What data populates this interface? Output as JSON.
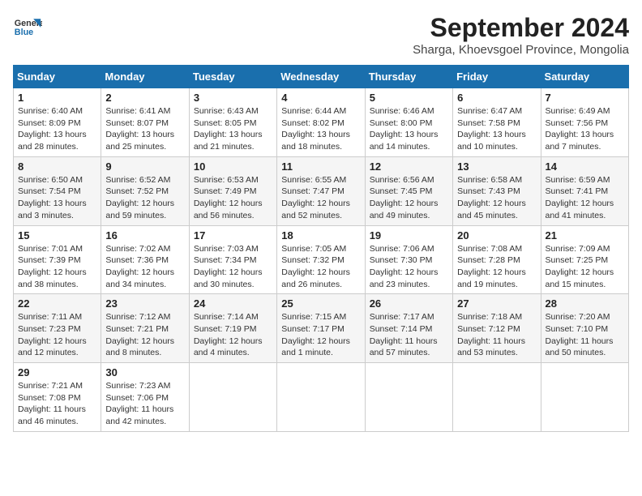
{
  "header": {
    "logo_line1": "General",
    "logo_line2": "Blue",
    "main_title": "September 2024",
    "subtitle": "Sharga, Khoevsgoel Province, Mongolia"
  },
  "calendar": {
    "days_of_week": [
      "Sunday",
      "Monday",
      "Tuesday",
      "Wednesday",
      "Thursday",
      "Friday",
      "Saturday"
    ],
    "weeks": [
      [
        null,
        {
          "day": "2",
          "sunrise": "Sunrise: 6:41 AM",
          "sunset": "Sunset: 8:07 PM",
          "daylight": "Daylight: 13 hours and 25 minutes."
        },
        {
          "day": "3",
          "sunrise": "Sunrise: 6:43 AM",
          "sunset": "Sunset: 8:05 PM",
          "daylight": "Daylight: 13 hours and 21 minutes."
        },
        {
          "day": "4",
          "sunrise": "Sunrise: 6:44 AM",
          "sunset": "Sunset: 8:02 PM",
          "daylight": "Daylight: 13 hours and 18 minutes."
        },
        {
          "day": "5",
          "sunrise": "Sunrise: 6:46 AM",
          "sunset": "Sunset: 8:00 PM",
          "daylight": "Daylight: 13 hours and 14 minutes."
        },
        {
          "day": "6",
          "sunrise": "Sunrise: 6:47 AM",
          "sunset": "Sunset: 7:58 PM",
          "daylight": "Daylight: 13 hours and 10 minutes."
        },
        {
          "day": "7",
          "sunrise": "Sunrise: 6:49 AM",
          "sunset": "Sunset: 7:56 PM",
          "daylight": "Daylight: 13 hours and 7 minutes."
        }
      ],
      [
        {
          "day": "1",
          "sunrise": "Sunrise: 6:40 AM",
          "sunset": "Sunset: 8:09 PM",
          "daylight": "Daylight: 13 hours and 28 minutes."
        },
        null,
        null,
        null,
        null,
        null,
        null
      ],
      [
        {
          "day": "8",
          "sunrise": "Sunrise: 6:50 AM",
          "sunset": "Sunset: 7:54 PM",
          "daylight": "Daylight: 13 hours and 3 minutes."
        },
        {
          "day": "9",
          "sunrise": "Sunrise: 6:52 AM",
          "sunset": "Sunset: 7:52 PM",
          "daylight": "Daylight: 12 hours and 59 minutes."
        },
        {
          "day": "10",
          "sunrise": "Sunrise: 6:53 AM",
          "sunset": "Sunset: 7:49 PM",
          "daylight": "Daylight: 12 hours and 56 minutes."
        },
        {
          "day": "11",
          "sunrise": "Sunrise: 6:55 AM",
          "sunset": "Sunset: 7:47 PM",
          "daylight": "Daylight: 12 hours and 52 minutes."
        },
        {
          "day": "12",
          "sunrise": "Sunrise: 6:56 AM",
          "sunset": "Sunset: 7:45 PM",
          "daylight": "Daylight: 12 hours and 49 minutes."
        },
        {
          "day": "13",
          "sunrise": "Sunrise: 6:58 AM",
          "sunset": "Sunset: 7:43 PM",
          "daylight": "Daylight: 12 hours and 45 minutes."
        },
        {
          "day": "14",
          "sunrise": "Sunrise: 6:59 AM",
          "sunset": "Sunset: 7:41 PM",
          "daylight": "Daylight: 12 hours and 41 minutes."
        }
      ],
      [
        {
          "day": "15",
          "sunrise": "Sunrise: 7:01 AM",
          "sunset": "Sunset: 7:39 PM",
          "daylight": "Daylight: 12 hours and 38 minutes."
        },
        {
          "day": "16",
          "sunrise": "Sunrise: 7:02 AM",
          "sunset": "Sunset: 7:36 PM",
          "daylight": "Daylight: 12 hours and 34 minutes."
        },
        {
          "day": "17",
          "sunrise": "Sunrise: 7:03 AM",
          "sunset": "Sunset: 7:34 PM",
          "daylight": "Daylight: 12 hours and 30 minutes."
        },
        {
          "day": "18",
          "sunrise": "Sunrise: 7:05 AM",
          "sunset": "Sunset: 7:32 PM",
          "daylight": "Daylight: 12 hours and 26 minutes."
        },
        {
          "day": "19",
          "sunrise": "Sunrise: 7:06 AM",
          "sunset": "Sunset: 7:30 PM",
          "daylight": "Daylight: 12 hours and 23 minutes."
        },
        {
          "day": "20",
          "sunrise": "Sunrise: 7:08 AM",
          "sunset": "Sunset: 7:28 PM",
          "daylight": "Daylight: 12 hours and 19 minutes."
        },
        {
          "day": "21",
          "sunrise": "Sunrise: 7:09 AM",
          "sunset": "Sunset: 7:25 PM",
          "daylight": "Daylight: 12 hours and 15 minutes."
        }
      ],
      [
        {
          "day": "22",
          "sunrise": "Sunrise: 7:11 AM",
          "sunset": "Sunset: 7:23 PM",
          "daylight": "Daylight: 12 hours and 12 minutes."
        },
        {
          "day": "23",
          "sunrise": "Sunrise: 7:12 AM",
          "sunset": "Sunset: 7:21 PM",
          "daylight": "Daylight: 12 hours and 8 minutes."
        },
        {
          "day": "24",
          "sunrise": "Sunrise: 7:14 AM",
          "sunset": "Sunset: 7:19 PM",
          "daylight": "Daylight: 12 hours and 4 minutes."
        },
        {
          "day": "25",
          "sunrise": "Sunrise: 7:15 AM",
          "sunset": "Sunset: 7:17 PM",
          "daylight": "Daylight: 12 hours and 1 minute."
        },
        {
          "day": "26",
          "sunrise": "Sunrise: 7:17 AM",
          "sunset": "Sunset: 7:14 PM",
          "daylight": "Daylight: 11 hours and 57 minutes."
        },
        {
          "day": "27",
          "sunrise": "Sunrise: 7:18 AM",
          "sunset": "Sunset: 7:12 PM",
          "daylight": "Daylight: 11 hours and 53 minutes."
        },
        {
          "day": "28",
          "sunrise": "Sunrise: 7:20 AM",
          "sunset": "Sunset: 7:10 PM",
          "daylight": "Daylight: 11 hours and 50 minutes."
        }
      ],
      [
        {
          "day": "29",
          "sunrise": "Sunrise: 7:21 AM",
          "sunset": "Sunset: 7:08 PM",
          "daylight": "Daylight: 11 hours and 46 minutes."
        },
        {
          "day": "30",
          "sunrise": "Sunrise: 7:23 AM",
          "sunset": "Sunset: 7:06 PM",
          "daylight": "Daylight: 11 hours and 42 minutes."
        },
        null,
        null,
        null,
        null,
        null
      ]
    ]
  }
}
